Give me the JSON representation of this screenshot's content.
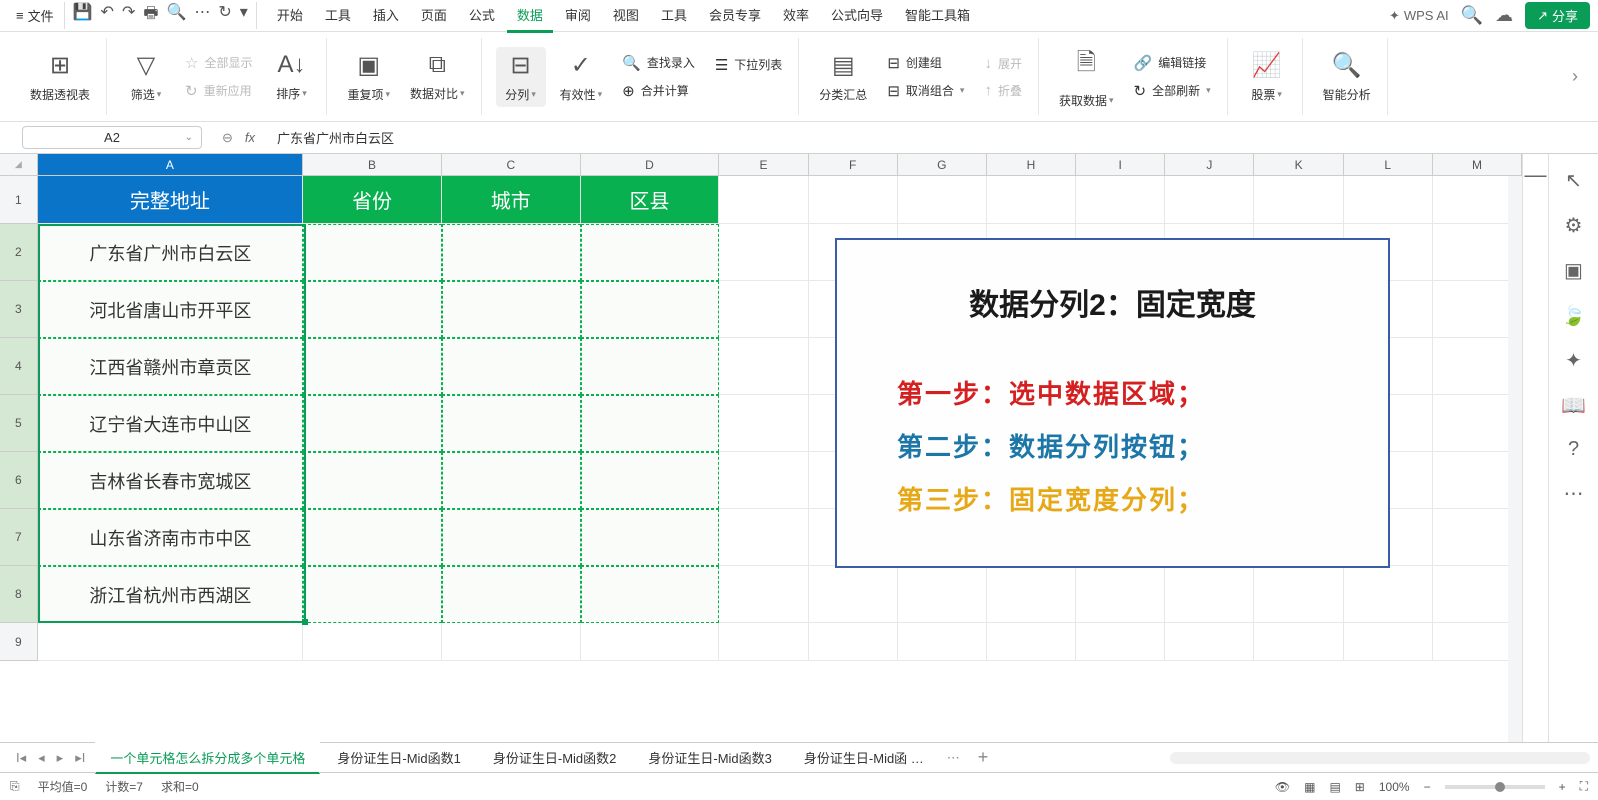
{
  "menubar": {
    "file": "文件",
    "tabs": [
      "开始",
      "工具",
      "插入",
      "页面",
      "公式",
      "数据",
      "审阅",
      "视图",
      "工具",
      "会员专享",
      "效率",
      "公式向导",
      "智能工具箱"
    ],
    "active_tab_index": 5,
    "wps_ai": "WPS AI",
    "share": "分享"
  },
  "ribbon": {
    "pivot": "数据透视表",
    "filter": "筛选",
    "show_all": "全部显示",
    "reapply": "重新应用",
    "sort": "排序",
    "duplicates": "重复项",
    "data_compare": "数据对比",
    "split": "分列",
    "validity": "有效性",
    "find_entry": "查找录入",
    "dropdown_list": "下拉列表",
    "consolidate": "合并计算",
    "subtotal": "分类汇总",
    "group": "创建组",
    "ungroup": "取消组合",
    "expand": "展开",
    "collapse": "折叠",
    "get_data": "获取数据",
    "edit_links": "编辑链接",
    "refresh_all": "全部刷新",
    "stocks": "股票",
    "smart_analysis": "智能分析"
  },
  "fbar": {
    "name_box": "A2",
    "formula": "广东省广州市白云区"
  },
  "columns": [
    "A",
    "B",
    "C",
    "D",
    "E",
    "F",
    "G",
    "H",
    "I",
    "J",
    "K",
    "L",
    "M"
  ],
  "headers": {
    "A": "完整地址",
    "B": "省份",
    "C": "城市",
    "D": "区县"
  },
  "rows": [
    "广东省广州市白云区",
    "河北省唐山市开平区",
    "江西省赣州市章贡区",
    "辽宁省大连市中山区",
    "吉林省长春市宽城区",
    "山东省济南市市中区",
    "浙江省杭州市西湖区"
  ],
  "info_box": {
    "title": "数据分列2：固定宽度",
    "step1": "第一步：选中数据区域；",
    "step2": "第二步：数据分列按钮；",
    "step3": "第三步：固定宽度分列；"
  },
  "sheet_tabs": {
    "active": "一个单元格怎么拆分成多个单元格",
    "others": [
      "身份证生日-Mid函数1",
      "身份证生日-Mid函数2",
      "身份证生日-Mid函数3",
      "身份证生日-Mid函 …"
    ]
  },
  "statusbar": {
    "avg": "平均值=0",
    "count": "计数=7",
    "sum": "求和=0",
    "zoom": "100%"
  }
}
